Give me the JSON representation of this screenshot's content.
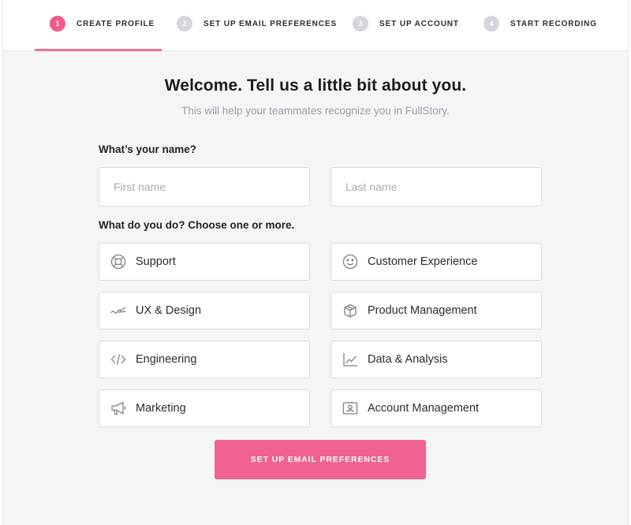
{
  "steps": [
    {
      "number": "1",
      "label": "CREATE PROFILE",
      "active": true
    },
    {
      "number": "2",
      "label": "SET UP EMAIL PREFERENCES",
      "active": false
    },
    {
      "number": "3",
      "label": "SET UP ACCOUNT",
      "active": false
    },
    {
      "number": "4",
      "label": "START RECORDING",
      "active": false
    }
  ],
  "heading": {
    "title": "Welcome. Tell us a little bit about you.",
    "subtitle": "This will help your teammates recognize you in FullStory."
  },
  "name_section": {
    "question": "What’s your name?",
    "first_name_placeholder": "First name",
    "last_name_placeholder": "Last name",
    "first_name_value": "",
    "last_name_value": ""
  },
  "role_section": {
    "question": "What do you do? Choose one or more.",
    "roles": [
      {
        "label": "Support",
        "icon": "lifebuoy-icon"
      },
      {
        "label": "Customer Experience",
        "icon": "smiley-icon"
      },
      {
        "label": "UX & Design",
        "icon": "pen-stroke-icon"
      },
      {
        "label": "Product Management",
        "icon": "box-icon"
      },
      {
        "label": "Engineering",
        "icon": "code-icon"
      },
      {
        "label": "Data & Analysis",
        "icon": "line-chart-icon"
      },
      {
        "label": "Marketing",
        "icon": "megaphone-icon"
      },
      {
        "label": "Account Management",
        "icon": "id-card-icon"
      }
    ]
  },
  "cta_label": "SET UP EMAIL PREFERENCES",
  "colors": {
    "accent": "#ef5b8a",
    "button": "#f0628f",
    "background": "#f5f5f6",
    "inactive_step": "#d3d6dc"
  }
}
